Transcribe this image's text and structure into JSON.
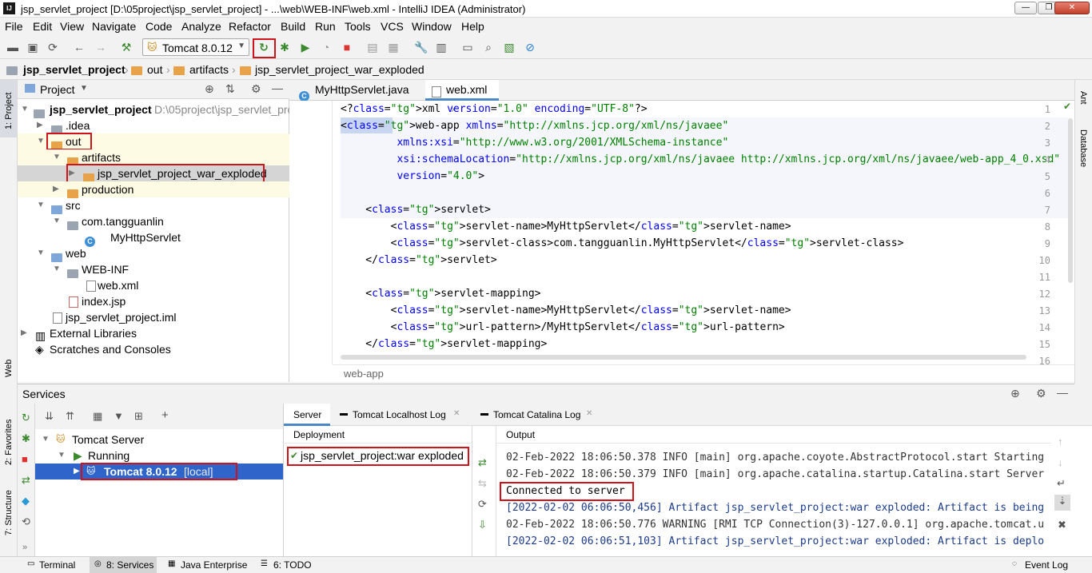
{
  "window": {
    "title": "jsp_servlet_project [D:\\05project\\jsp_servlet_project] - ...\\web\\WEB-INF\\web.xml - IntelliJ IDEA (Administrator)",
    "logo": "IJ"
  },
  "menu": [
    "File",
    "Edit",
    "View",
    "Navigate",
    "Code",
    "Analyze",
    "Refactor",
    "Build",
    "Run",
    "Tools",
    "VCS",
    "Window",
    "Help"
  ],
  "toolbar": {
    "run_config": "Tomcat 8.0.12"
  },
  "breadcrumb": [
    "jsp_servlet_project",
    "out",
    "artifacts",
    "jsp_servlet_project_war_exploded"
  ],
  "left_stripe": {
    "project": "1: Project",
    "web": "Web",
    "favorites": "2: Favorites",
    "structure": "7: Structure"
  },
  "right_stripe": {
    "ant": "Ant",
    "database": "Database"
  },
  "project_panel": {
    "title": "Project",
    "root_name": "jsp_servlet_project",
    "root_path": "D:\\05project\\jsp_servlet_proj",
    "items": [
      {
        "label": "jsp_servlet_project",
        "path": "D:\\05project\\jsp_servlet_pro"
      },
      {
        "label": ".idea"
      },
      {
        "label": "out"
      },
      {
        "label": "artifacts"
      },
      {
        "label": "jsp_servlet_project_war_exploded"
      },
      {
        "label": "production"
      },
      {
        "label": "src"
      },
      {
        "label": "com.tangguanlin"
      },
      {
        "label": "MyHttpServlet"
      },
      {
        "label": "web"
      },
      {
        "label": "WEB-INF"
      },
      {
        "label": "web.xml"
      },
      {
        "label": "index.jsp"
      },
      {
        "label": "jsp_servlet_project.iml"
      },
      {
        "label": "External Libraries"
      },
      {
        "label": "Scratches and Consoles"
      }
    ]
  },
  "editor": {
    "tabs": [
      {
        "label": "MyHttpServlet.java"
      },
      {
        "label": "web.xml"
      }
    ],
    "line_numbers": [
      "1",
      "2",
      "3",
      "4",
      "5",
      "6",
      "7",
      "8",
      "9",
      "10",
      "11",
      "12",
      "13",
      "14",
      "15",
      "16"
    ],
    "lines": [
      "<?xml version=\"1.0\" encoding=\"UTF-8\"?>",
      "<web-app xmlns=\"http://xmlns.jcp.org/xml/ns/javaee\"",
      "         xmlns:xsi=\"http://www.w3.org/2001/XMLSchema-instance\"",
      "         xsi:schemaLocation=\"http://xmlns.jcp.org/xml/ns/javaee http://xmlns.jcp.org/xml/ns/javaee/web-app_4_0.xsd\"",
      "         version=\"4.0\">",
      "",
      "    <servlet>",
      "        <servlet-name>MyHttpServlet</servlet-name>",
      "        <servlet-class>com.tangguanlin.MyHttpServlet</servlet-class>",
      "    </servlet>",
      "",
      "    <servlet-mapping>",
      "        <servlet-name>MyHttpServlet</servlet-name>",
      "        <url-pattern>/MyHttpServlet</url-pattern>",
      "    </servlet-mapping>",
      ""
    ],
    "footer_path": "web-app"
  },
  "services": {
    "title": "Services",
    "tree": [
      {
        "label": "Tomcat Server"
      },
      {
        "label": "Running"
      },
      {
        "label": "Tomcat 8.0.12",
        "suffix": "[local]"
      }
    ],
    "subtabs": [
      "Server",
      "Tomcat Localhost Log",
      "Tomcat Catalina Log"
    ],
    "deployment_header": "Deployment",
    "deployment_item": "jsp_servlet_project:war exploded",
    "output_header": "Output",
    "output_lines": [
      {
        "text": "02-Feb-2022 18:06:50.378 INFO [main] org.apache.coyote.AbstractProtocol.start Starting",
        "color": "#333333"
      },
      {
        "text": "02-Feb-2022 18:06:50.379 INFO [main] org.apache.catalina.startup.Catalina.start Server",
        "color": "#333333"
      },
      {
        "text": "Connected to server",
        "color": "#000000"
      },
      {
        "text": "[2022-02-02 06:06:50,456] Artifact jsp_servlet_project:war exploded: Artifact is being",
        "color": "#1a3a8a"
      },
      {
        "text": "02-Feb-2022 18:06:50.776 WARNING [RMI TCP Connection(3)-127.0.0.1] org.apache.tomcat.u",
        "color": "#333333"
      },
      {
        "text": "[2022-02-02 06:06:51,103] Artifact jsp_servlet_project:war exploded: Artifact is deplo",
        "color": "#1a3a8a"
      }
    ]
  },
  "statusbar": {
    "terminal": "Terminal",
    "services": "8: Services",
    "java_enterprise": "Java Enterprise",
    "todo": "6: TODO",
    "event_log": "Event Log"
  }
}
